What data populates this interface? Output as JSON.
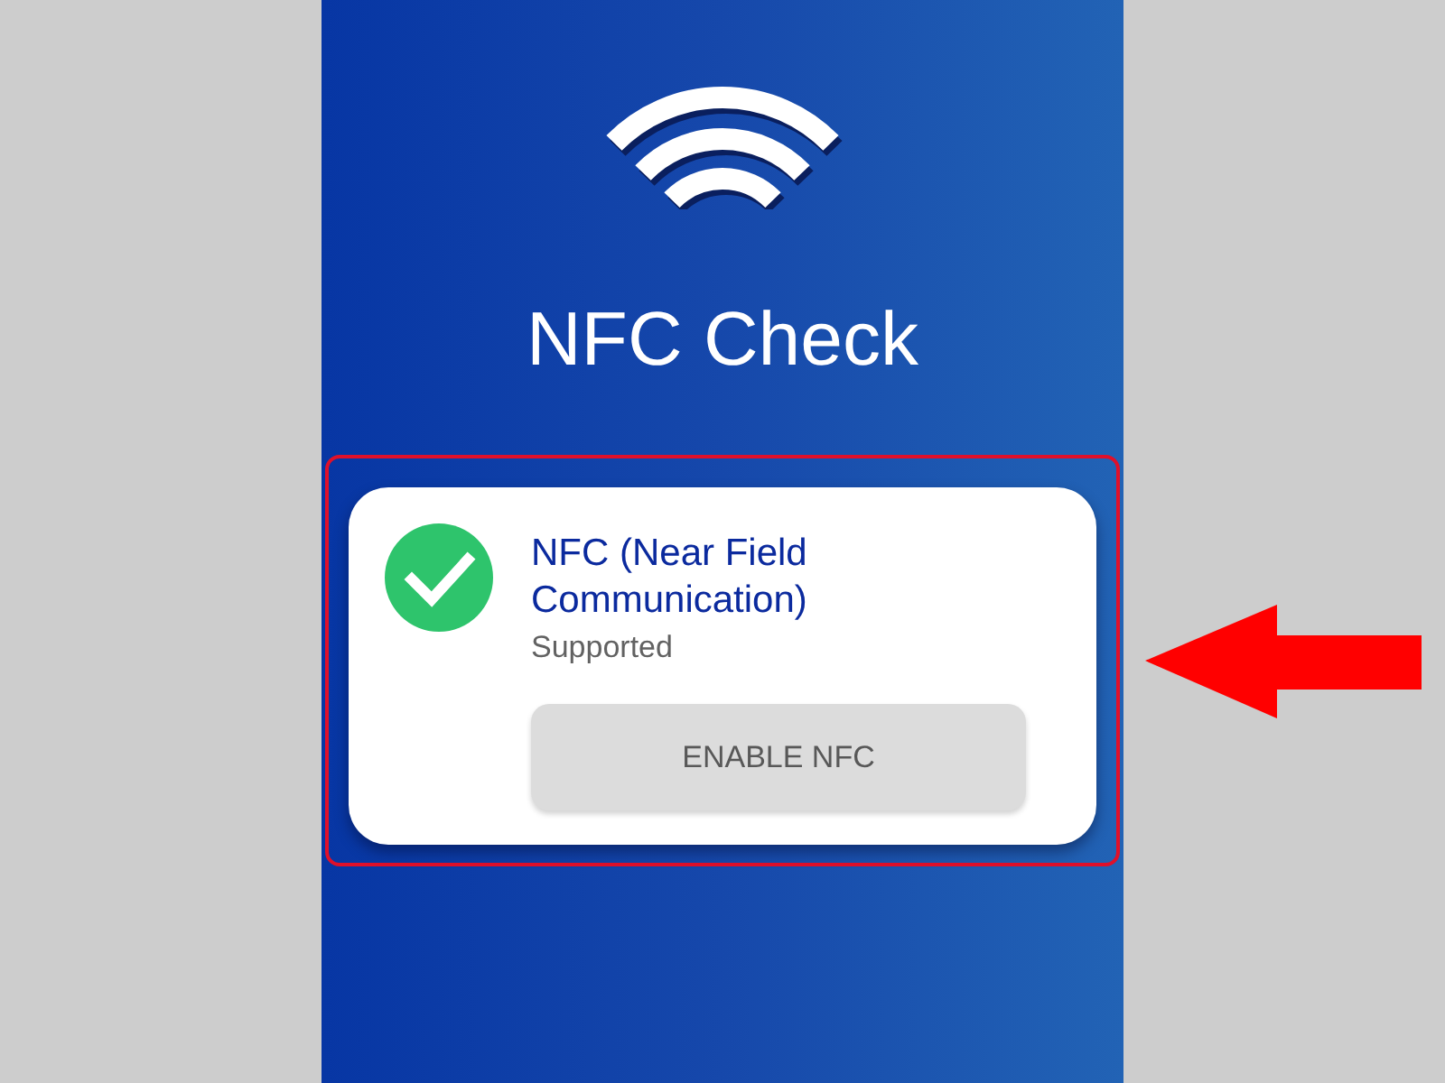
{
  "screen": {
    "title": "NFC Check"
  },
  "feature": {
    "name": "NFC (Near Field Communication)",
    "status": "Supported",
    "supported": true,
    "highlighted": true,
    "pointed_to": true,
    "button": {
      "label": "ENABLE NFC",
      "disabled": true
    }
  }
}
